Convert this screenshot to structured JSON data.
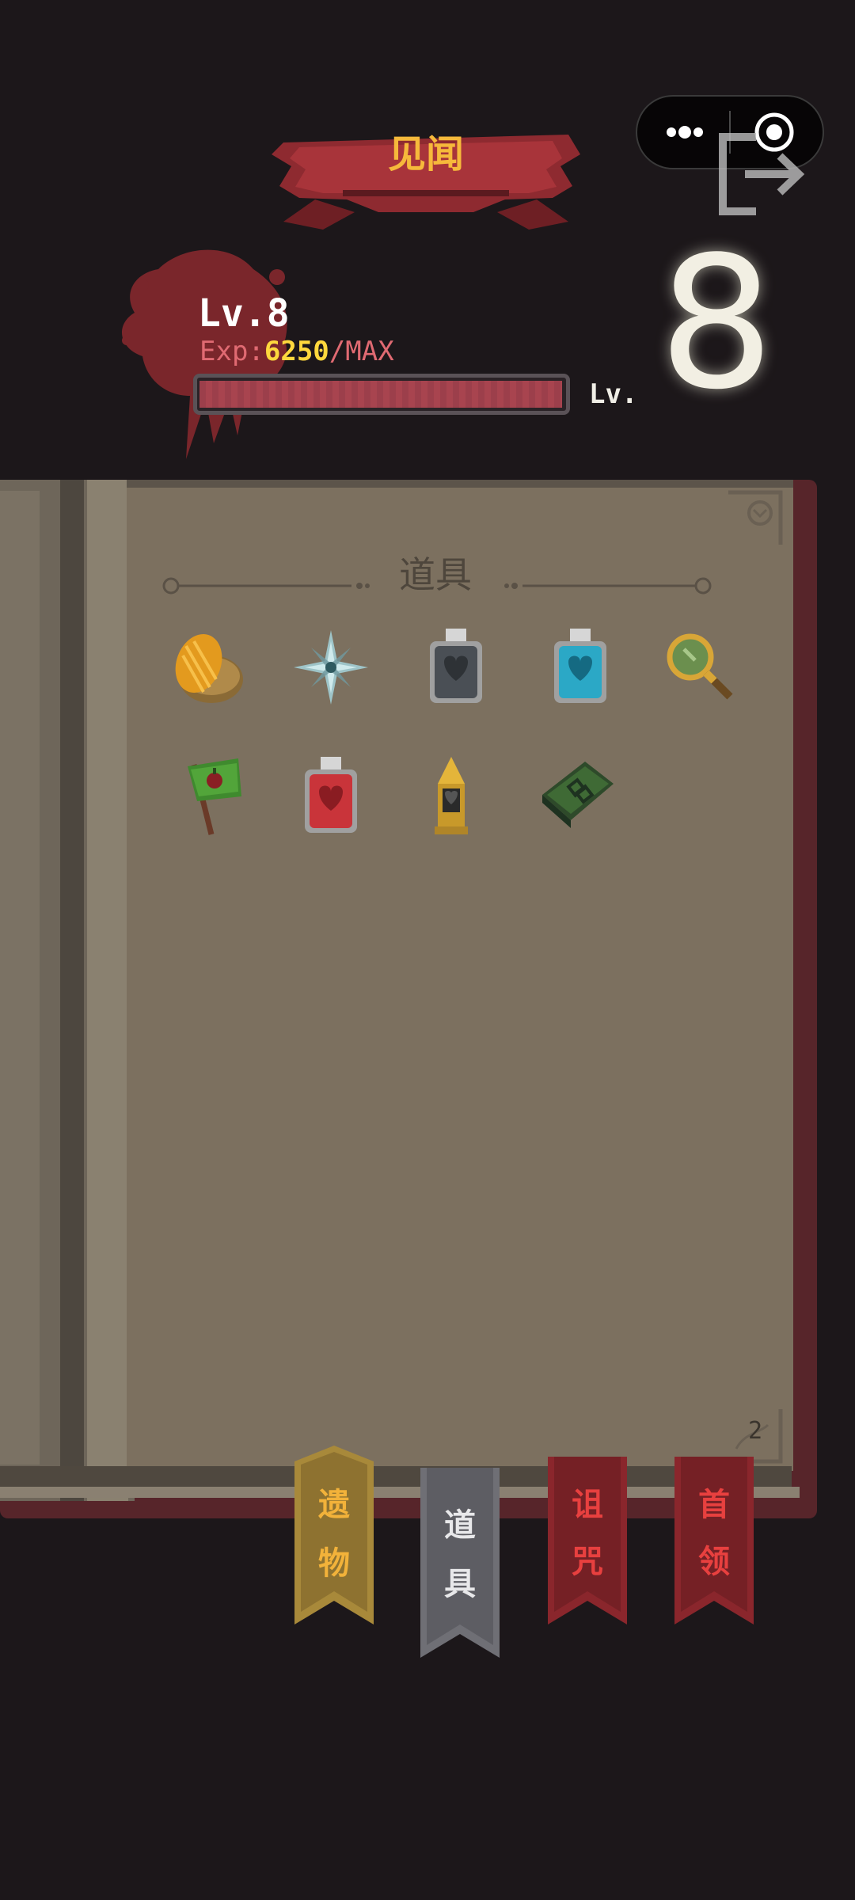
{
  "header": {
    "title": "见闻"
  },
  "capsule": {
    "more_icon": "more-dots-icon",
    "close_icon": "target-circle-icon"
  },
  "exit_icon": "exit-door-icon",
  "player": {
    "level_label": "Lv.8",
    "exp_prefix": "Exp:",
    "exp_value": "6250",
    "exp_suffix": "/MAX",
    "exp_progress": 1.0,
    "big_level_prefix": "Lv.",
    "big_level_number": "8"
  },
  "book": {
    "section_title": "道具",
    "page_number": "2",
    "items": [
      {
        "icon": "golden-potato-icon"
      },
      {
        "icon": "ice-compass-star-icon"
      },
      {
        "icon": "gray-heart-bottle-icon"
      },
      {
        "icon": "blue-heart-bottle-icon"
      },
      {
        "icon": "magnifying-glass-icon"
      },
      {
        "icon": "green-flag-icon"
      },
      {
        "icon": "red-heart-bottle-icon"
      },
      {
        "icon": "bullet-icon"
      },
      {
        "icon": "green-book-icon"
      }
    ]
  },
  "tabs": [
    {
      "label_top": "遗",
      "label_bottom": "物",
      "color": "#a8893a",
      "text_color": "#f2b23a"
    },
    {
      "label_top": "道",
      "label_bottom": "具",
      "color": "#6f6f75",
      "text_color": "#e8e8ea",
      "selected": true
    },
    {
      "label_top": "诅",
      "label_bottom": "咒",
      "color": "#8a262c",
      "text_color": "#e8403f"
    },
    {
      "label_top": "首",
      "label_bottom": "领",
      "color": "#8a262c",
      "text_color": "#e8403f"
    }
  ],
  "colors": {
    "background": "#1c171a",
    "page": "#7c705f",
    "accent_gold": "#f6b93b",
    "exp_value": "#ffd83d",
    "exp_text": "#e06a72"
  }
}
